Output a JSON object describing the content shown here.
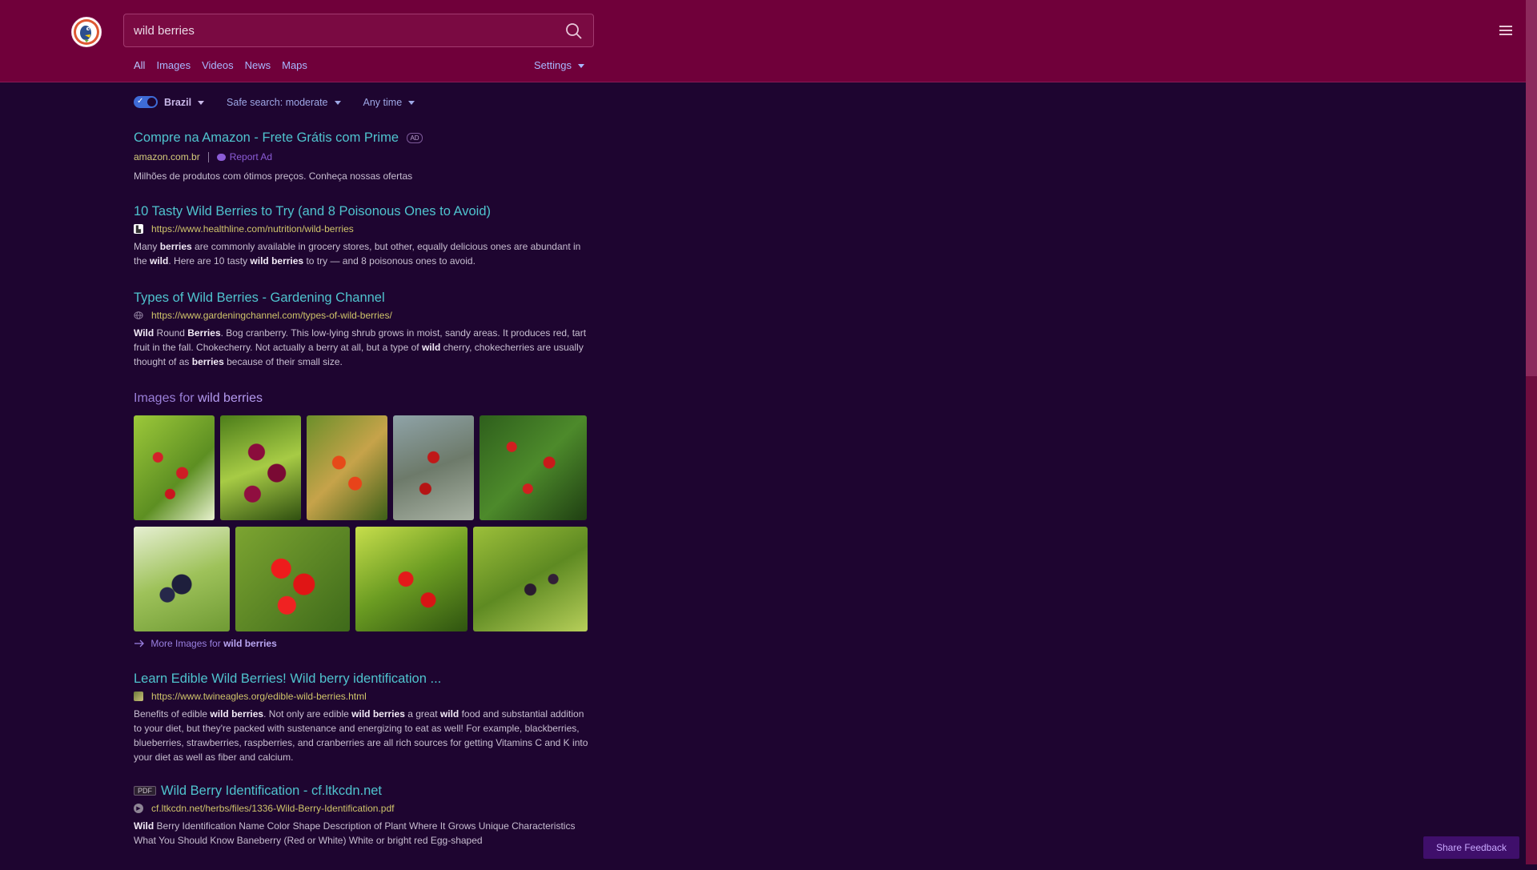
{
  "header": {
    "search_value": "wild berries",
    "nav": [
      "All",
      "Images",
      "Videos",
      "News",
      "Maps"
    ],
    "settings_label": "Settings"
  },
  "filters": {
    "region": "Brazil",
    "safe_search": "Safe search: moderate",
    "time": "Any time"
  },
  "ad": {
    "title": "Compre na Amazon - Frete Grátis com Prime",
    "badge": "AD",
    "domain": "amazon.com.br",
    "report": "Report Ad",
    "snippet": "Milhões de produtos com ótimos preços. Conheça nossas ofertas"
  },
  "results": [
    {
      "title": "10 Tasty Wild Berries to Try (and 8 Poisonous Ones to Avoid)",
      "url": "https://www.healthline.com/nutrition/wild-berries"
    },
    {
      "title": "Types of Wild Berries - Gardening Channel",
      "url": "https://www.gardeningchannel.com/types-of-wild-berries/"
    }
  ],
  "images_section": {
    "heading_prefix": "Images for",
    "heading_query": "wild berries",
    "more_prefix": "More Images for",
    "more_query": "wild berries"
  },
  "results_after": [
    {
      "title": "Learn Edible Wild Berries! Wild berry identification ...",
      "url": "https://www.twineagles.org/edible-wild-berries.html"
    },
    {
      "badge": "PDF",
      "title": "Wild Berry Identification - cf.ltkcdn.net",
      "url": "cf.ltkcdn.net/herbs/files/1336-Wild-Berry-Identification.pdf"
    }
  ],
  "feedback_label": "Share Feedback",
  "colors": {
    "header_bg": "#70003a",
    "page_bg": "#1e0530",
    "title_link": "#4fc3ce",
    "url": "#cfc46a"
  }
}
